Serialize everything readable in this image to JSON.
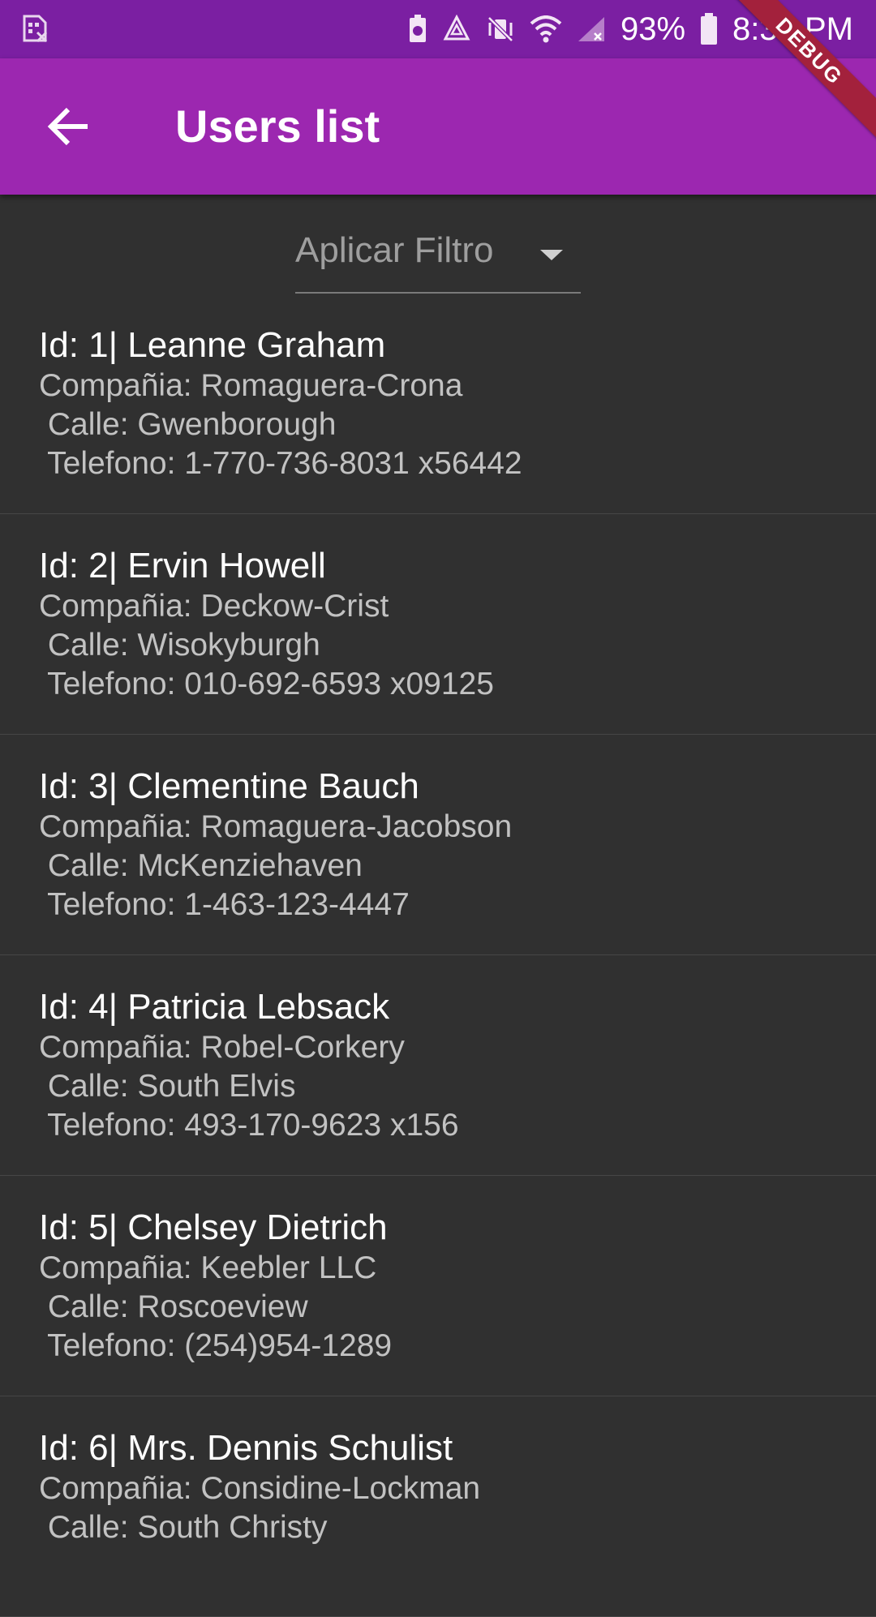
{
  "status_bar": {
    "battery_percent": "93%",
    "time": "8:38 PM"
  },
  "app_bar": {
    "title": "Users list",
    "debug_banner": "DEBUG"
  },
  "filter": {
    "label": "Aplicar Filtro"
  },
  "users": [
    {
      "title": "Id: 1| Leanne Graham",
      "company": "Compañia: Romaguera-Crona",
      "street": " Calle: Gwenborough",
      "phone": " Telefono: 1-770-736-8031 x56442"
    },
    {
      "title": "Id: 2| Ervin Howell",
      "company": "Compañia: Deckow-Crist",
      "street": " Calle: Wisokyburgh",
      "phone": " Telefono: 010-692-6593 x09125"
    },
    {
      "title": "Id: 3| Clementine Bauch",
      "company": "Compañia: Romaguera-Jacobson",
      "street": " Calle: McKenziehaven",
      "phone": " Telefono: 1-463-123-4447"
    },
    {
      "title": "Id: 4| Patricia Lebsack",
      "company": "Compañia: Robel-Corkery",
      "street": " Calle: South Elvis",
      "phone": " Telefono: 493-170-9623 x156"
    },
    {
      "title": "Id: 5| Chelsey Dietrich",
      "company": "Compañia: Keebler LLC",
      "street": " Calle: Roscoeview",
      "phone": " Telefono: (254)954-1289"
    },
    {
      "title": "Id: 6| Mrs. Dennis Schulist",
      "company": "Compañia: Considine-Lockman",
      "street": " Calle: South Christy",
      "phone": ""
    }
  ],
  "colors": {
    "status_bar": "#7b1fa2",
    "app_bar": "#9c27b0",
    "background": "#303030",
    "debug_banner": "#a3213c"
  }
}
